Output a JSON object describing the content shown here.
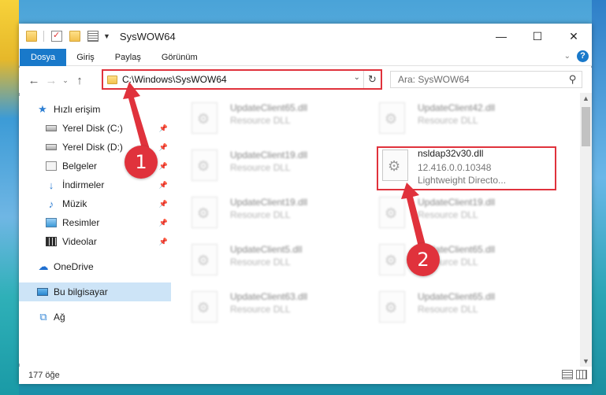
{
  "window": {
    "title": "SysWOW64",
    "controls": {
      "minimize": "—",
      "maximize": "☐",
      "close": "✕"
    }
  },
  "ribbon": {
    "tabs": [
      {
        "label": "Dosya",
        "active": true
      },
      {
        "label": "Giriş",
        "active": false
      },
      {
        "label": "Paylaş",
        "active": false
      },
      {
        "label": "Görünüm",
        "active": false
      }
    ],
    "help": "?"
  },
  "nav": {
    "back": "←",
    "forward": "→",
    "recent": "⌄",
    "up": "↑",
    "address": "C:\\Windows\\SysWOW64",
    "refresh": "↻",
    "search_placeholder": "Ara: SysWOW64"
  },
  "sidebar": {
    "items": [
      {
        "label": "Hızlı erişim",
        "icon": "star-icon",
        "pinned": false
      },
      {
        "label": "Yerel Disk (C:)",
        "icon": "disk-icon",
        "pinned": true
      },
      {
        "label": "Yerel Disk (D:)",
        "icon": "disk-icon",
        "pinned": true
      },
      {
        "label": "Belgeler",
        "icon": "documents-icon",
        "pinned": true
      },
      {
        "label": "İndirmeler",
        "icon": "downloads-icon",
        "pinned": true
      },
      {
        "label": "Müzik",
        "icon": "music-icon",
        "pinned": true
      },
      {
        "label": "Resimler",
        "icon": "pictures-icon",
        "pinned": true
      },
      {
        "label": "Videolar",
        "icon": "videos-icon",
        "pinned": true
      },
      {
        "label": "OneDrive",
        "icon": "onedrive-icon",
        "pinned": false
      },
      {
        "label": "Bu bilgisayar",
        "icon": "this-pc-icon",
        "pinned": false,
        "selected": true
      },
      {
        "label": "Ağ",
        "icon": "network-icon",
        "pinned": false
      }
    ]
  },
  "files": [
    {
      "name": "UpdateClient65.dll",
      "desc": "Resource DLL"
    },
    {
      "name": "UpdateClient42.dll",
      "desc": "Resource DLL"
    },
    {
      "name": "UpdateClient19.dll",
      "desc": "Resource DLL"
    },
    {
      "name": "nsldap32v30.dll",
      "version": "12.416.0.0.10348",
      "desc": "Lightweight Directo...",
      "highlighted": true
    },
    {
      "name": "UpdateClient19.dll",
      "desc": "Resource DLL"
    },
    {
      "name": "UpdateClient19.dll",
      "desc": "Resource DLL"
    },
    {
      "name": "UpdateClient5.dll",
      "desc": "Resource DLL"
    },
    {
      "name": "UpdateClient65.dll",
      "desc": "Resource DLL"
    },
    {
      "name": "UpdateClient63.dll",
      "desc": "Resource DLL"
    },
    {
      "name": "UpdateClient65.dll",
      "desc": "Resource DLL"
    }
  ],
  "status": {
    "count": "177 öğe"
  },
  "annotations": {
    "step1": "1",
    "step2": "2",
    "color": "#e0323c"
  }
}
